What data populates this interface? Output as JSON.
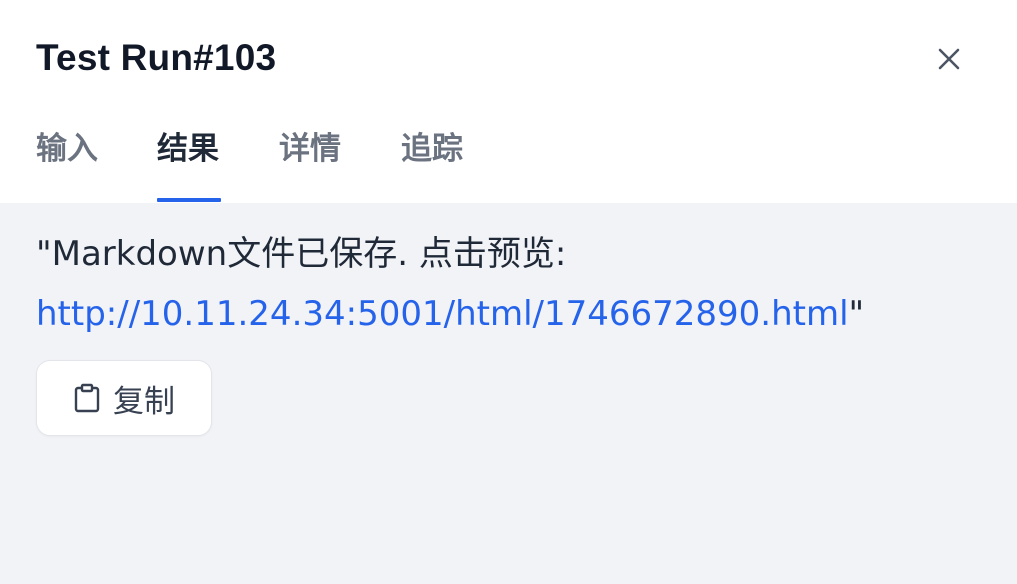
{
  "header": {
    "title": "Test Run#103",
    "close_icon": "close-icon"
  },
  "tabs": [
    {
      "label": "输入",
      "active": false
    },
    {
      "label": "结果",
      "active": true
    },
    {
      "label": "详情",
      "active": false
    },
    {
      "label": "追踪",
      "active": false
    }
  ],
  "result": {
    "prefix_text": "\"Markdown文件已保存. 点击预览: ",
    "link_text": "http://10.11.24.34:5001/html/1746672890.html",
    "suffix_text": "\""
  },
  "copy_button": {
    "label": "复制",
    "icon": "clipboard-icon"
  },
  "colors": {
    "accent": "#2563eb",
    "background": "#f2f3f7",
    "header_background": "#ffffff"
  }
}
